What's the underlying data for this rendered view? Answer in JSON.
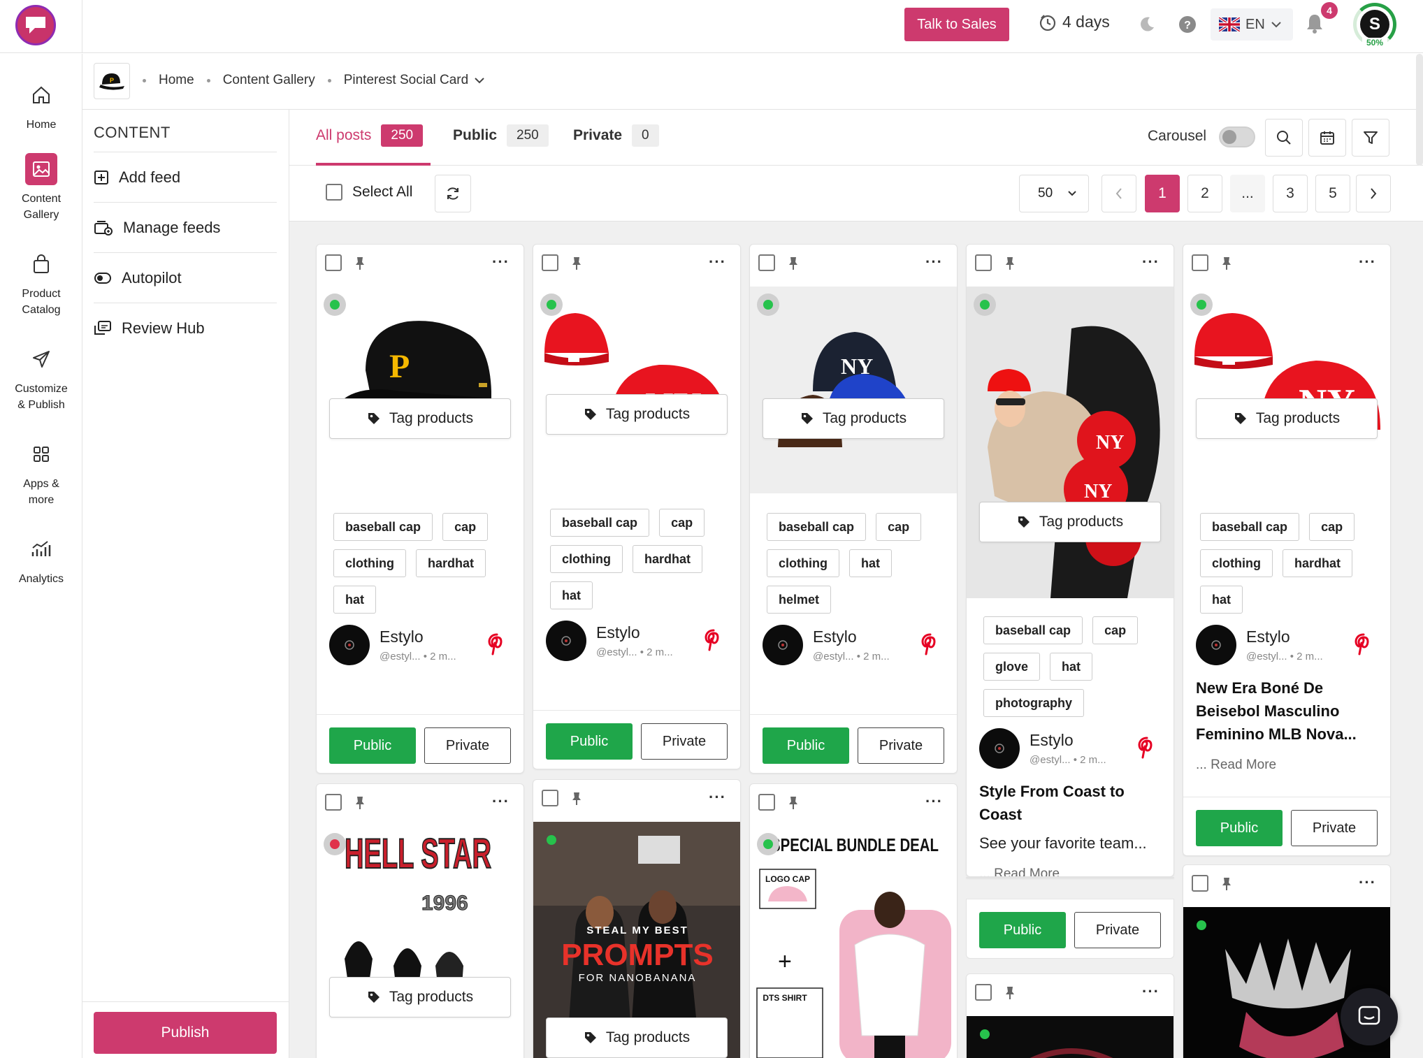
{
  "header": {
    "talk_to_sales": "Talk to Sales",
    "trial_days": "4 days",
    "language": "EN",
    "notification_count": "4",
    "avatar_letter": "S",
    "profile_progress": "50%"
  },
  "nav": {
    "items": [
      {
        "label": "Home",
        "icon": "home-icon"
      },
      {
        "label": "Content Gallery",
        "icon": "image-icon"
      },
      {
        "label": "Product Catalog",
        "icon": "bag-icon"
      },
      {
        "label": "Customize & Publish",
        "icon": "send-icon"
      },
      {
        "label": "Apps & more",
        "icon": "grid-icon"
      },
      {
        "label": "Analytics",
        "icon": "analytics-icon"
      }
    ]
  },
  "breadcrumb": {
    "home": "Home",
    "gallery": "Content Gallery",
    "current": "Pinterest Social Card"
  },
  "content_sidebar": {
    "title": "CONTENT",
    "items": [
      "Add feed",
      "Manage feeds",
      "Autopilot",
      "Review Hub"
    ],
    "publish": "Publish"
  },
  "tabs": {
    "all": {
      "label": "All posts",
      "count": "250"
    },
    "public": {
      "label": "Public",
      "count": "250"
    },
    "private": {
      "label": "Private",
      "count": "0"
    },
    "carousel": "Carousel"
  },
  "toolbar": {
    "select_all": "Select All",
    "per_page": "50",
    "pages": [
      "1",
      "2",
      "...",
      "3",
      "5"
    ],
    "current_page": "1"
  },
  "common": {
    "tag_products": "Tag products",
    "public": "Public",
    "private": "Private",
    "author_name": "Estylo",
    "author_handle": "@estyl...",
    "author_time": "2 m...",
    "read_more": "... Read More"
  },
  "cards": [
    {
      "tags": [
        "baseball cap",
        "cap",
        "clothing",
        "hardhat",
        "hat"
      ]
    },
    {
      "tags": [
        "baseball cap",
        "cap",
        "clothing",
        "hardhat",
        "hat"
      ]
    },
    {
      "tags": [
        "baseball cap",
        "cap",
        "clothing",
        "hat",
        "helmet"
      ]
    },
    {
      "tags": [
        "baseball cap",
        "cap",
        "glove",
        "hat",
        "photography"
      ],
      "title": "Style From Coast to Coast",
      "desc": "See your favorite team..."
    },
    {
      "tags": [
        "baseball cap",
        "cap",
        "clothing",
        "hardhat",
        "hat"
      ],
      "title": "New Era Boné De Beisebol Masculino Feminino MLB Nova..."
    }
  ],
  "posters": {
    "hellstar": "HELL STAR",
    "hellstar_year": "1996",
    "prompts_line1": "STEAL MY BEST",
    "prompts_line2": "PROMPTS",
    "prompts_line3": "FOR NANOBANANA",
    "bundle_title": "SPECIAL BUNDLE DEAL",
    "bundle_logo_cap": "LOGO CAP",
    "bundle_dts": "DTS SHIRT"
  },
  "colors": {
    "brand": "#cd3a6e",
    "public_green": "#1fa64a",
    "status_green": "#27c24c",
    "status_red": "#e0324b"
  }
}
